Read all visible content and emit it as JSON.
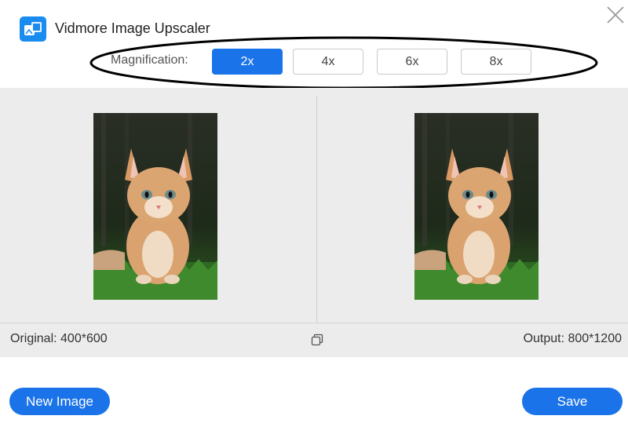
{
  "app": {
    "title": "Vidmore Image Upscaler",
    "logo_icon": "image-upscaler-logo-icon"
  },
  "magnification": {
    "label": "Magnification:",
    "options": [
      "2x",
      "4x",
      "6x",
      "8x"
    ],
    "selected": "2x"
  },
  "preview": {
    "original_label": "Original: 400*600",
    "output_label": "Output: 800*1200"
  },
  "actions": {
    "new_image": "New Image",
    "save": "Save"
  },
  "colors": {
    "accent": "#1a73e8",
    "panel_bg": "#ececed"
  },
  "icons": {
    "close": "close-icon",
    "compare": "compare-icon"
  }
}
